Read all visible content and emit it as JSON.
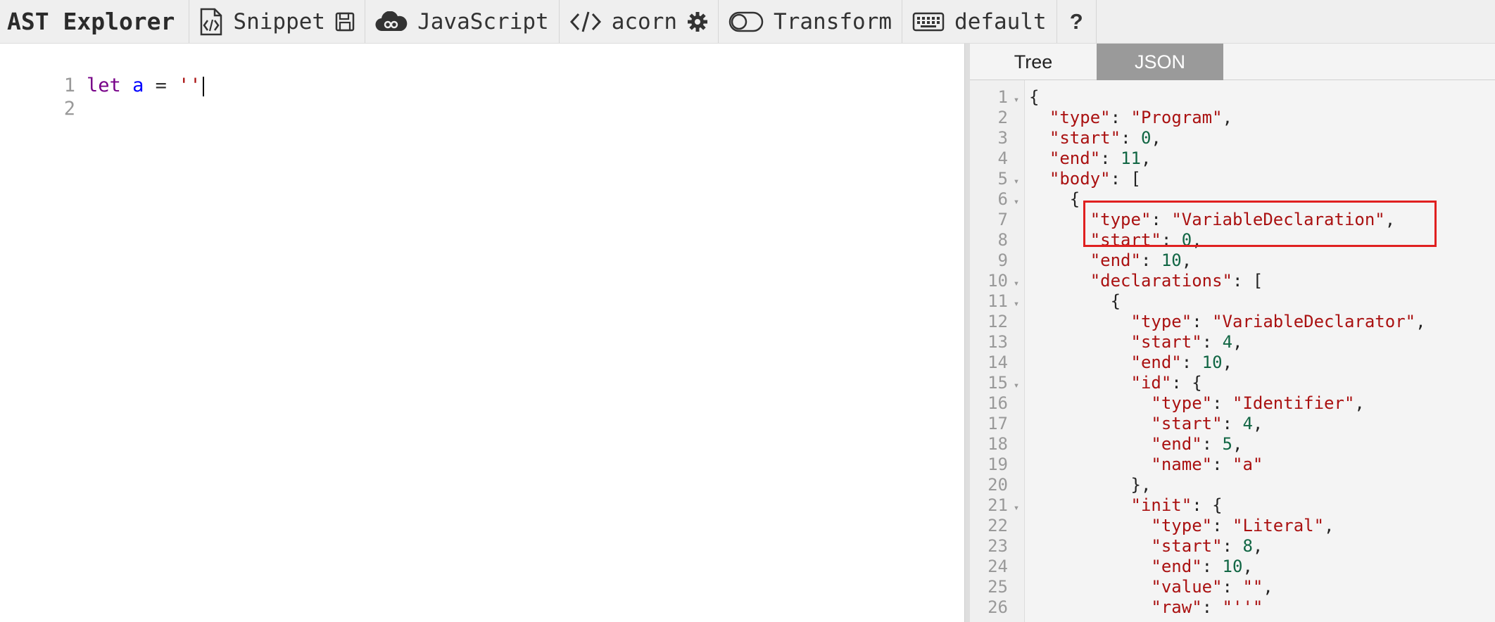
{
  "toolbar": {
    "brand": "AST Explorer",
    "snippet_label": "Snippet",
    "language_label": "JavaScript",
    "parser_label": "acorn",
    "transform_label": "Transform",
    "keymap_label": "default",
    "help_label": "?"
  },
  "editor": {
    "lines": [
      {
        "number": "1",
        "keyword": "let",
        "variable": "a",
        "operator": "=",
        "string": "''"
      },
      {
        "number": "2"
      }
    ]
  },
  "output": {
    "tabs": {
      "tree": "Tree",
      "json": "JSON"
    },
    "active_tab": "JSON",
    "json_lines": [
      {
        "n": "1",
        "fold": true,
        "indent": 0,
        "text": "{"
      },
      {
        "n": "2",
        "indent": 1,
        "key": "type",
        "str": "Program",
        "tail": ","
      },
      {
        "n": "3",
        "indent": 1,
        "key": "start",
        "num": "0",
        "tail": ","
      },
      {
        "n": "4",
        "indent": 1,
        "key": "end",
        "num": "11",
        "tail": ","
      },
      {
        "n": "5",
        "fold": true,
        "indent": 1,
        "key": "body",
        "tail": " ["
      },
      {
        "n": "6",
        "fold": true,
        "indent": 2,
        "text": "{"
      },
      {
        "n": "7",
        "indent": 3,
        "key": "type",
        "str": "VariableDeclaration",
        "tail": ","
      },
      {
        "n": "8",
        "indent": 3,
        "key": "start",
        "num": "0",
        "tail": ","
      },
      {
        "n": "9",
        "indent": 3,
        "key": "end",
        "num": "10",
        "tail": ","
      },
      {
        "n": "10",
        "fold": true,
        "indent": 3,
        "key": "declarations",
        "tail": " ["
      },
      {
        "n": "11",
        "fold": true,
        "indent": 4,
        "text": "{"
      },
      {
        "n": "12",
        "indent": 5,
        "key": "type",
        "str": "VariableDeclarator",
        "tail": ","
      },
      {
        "n": "13",
        "indent": 5,
        "key": "start",
        "num": "4",
        "tail": ","
      },
      {
        "n": "14",
        "indent": 5,
        "key": "end",
        "num": "10",
        "tail": ","
      },
      {
        "n": "15",
        "fold": true,
        "indent": 5,
        "key": "id",
        "tail": " {"
      },
      {
        "n": "16",
        "indent": 6,
        "key": "type",
        "str": "Identifier",
        "tail": ","
      },
      {
        "n": "17",
        "indent": 6,
        "key": "start",
        "num": "4",
        "tail": ","
      },
      {
        "n": "18",
        "indent": 6,
        "key": "end",
        "num": "5",
        "tail": ","
      },
      {
        "n": "19",
        "indent": 6,
        "key": "name",
        "str": "a",
        "tail": ""
      },
      {
        "n": "20",
        "indent": 5,
        "text": "},"
      },
      {
        "n": "21",
        "fold": true,
        "indent": 5,
        "key": "init",
        "tail": " {"
      },
      {
        "n": "22",
        "indent": 6,
        "key": "type",
        "str": "Literal",
        "tail": ","
      },
      {
        "n": "23",
        "indent": 6,
        "key": "start",
        "num": "8",
        "tail": ","
      },
      {
        "n": "24",
        "indent": 6,
        "key": "end",
        "num": "10",
        "tail": ","
      },
      {
        "n": "25",
        "indent": 6,
        "key": "value",
        "str": "",
        "tail": ","
      },
      {
        "n": "26",
        "indent": 6,
        "key": "raw",
        "str": "''",
        "tail": ""
      }
    ]
  },
  "colors": {
    "toolbar_bg": "#efefef",
    "keyword": "#770088",
    "variable": "#0000ff",
    "string": "#aa1111",
    "number": "#116644",
    "highlight": "#e02020",
    "active_tab_bg": "#9a9a9a"
  },
  "icons": [
    "file-code-icon",
    "save-icon",
    "cloud-icon",
    "code-brackets-icon",
    "gear-icon",
    "toggle-icon",
    "keyboard-icon"
  ]
}
